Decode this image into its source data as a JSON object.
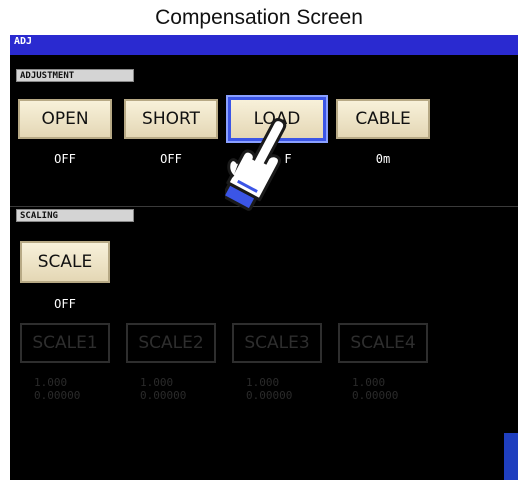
{
  "title": "Compensation Screen",
  "topbar": {
    "label": "ADJ"
  },
  "adjustment": {
    "label": "ADJUSTMENT",
    "buttons": [
      {
        "label": "OPEN",
        "status": "OFF"
      },
      {
        "label": "SHORT",
        "status": "OFF"
      },
      {
        "label": "LOAD",
        "status": "F"
      },
      {
        "label": "CABLE",
        "status": "0m"
      }
    ]
  },
  "scaling": {
    "label": "SCALING",
    "scale_button": {
      "label": "SCALE",
      "status": "OFF"
    },
    "scale_items": [
      {
        "label": "SCALE1",
        "a": "1.000",
        "b": "0.00000"
      },
      {
        "label": "SCALE2",
        "a": "1.000",
        "b": "0.00000"
      },
      {
        "label": "SCALE3",
        "a": "1.000",
        "b": "0.00000"
      },
      {
        "label": "SCALE4",
        "a": "1.000",
        "b": "0.00000"
      }
    ]
  },
  "colors": {
    "topbar": "#2a2ad0",
    "selected_border": "#3b55e6",
    "button_face": "#f0e6c8",
    "hand_fill": "#3b55e6"
  },
  "icons": {
    "pointer": "pointing-hand-icon"
  }
}
